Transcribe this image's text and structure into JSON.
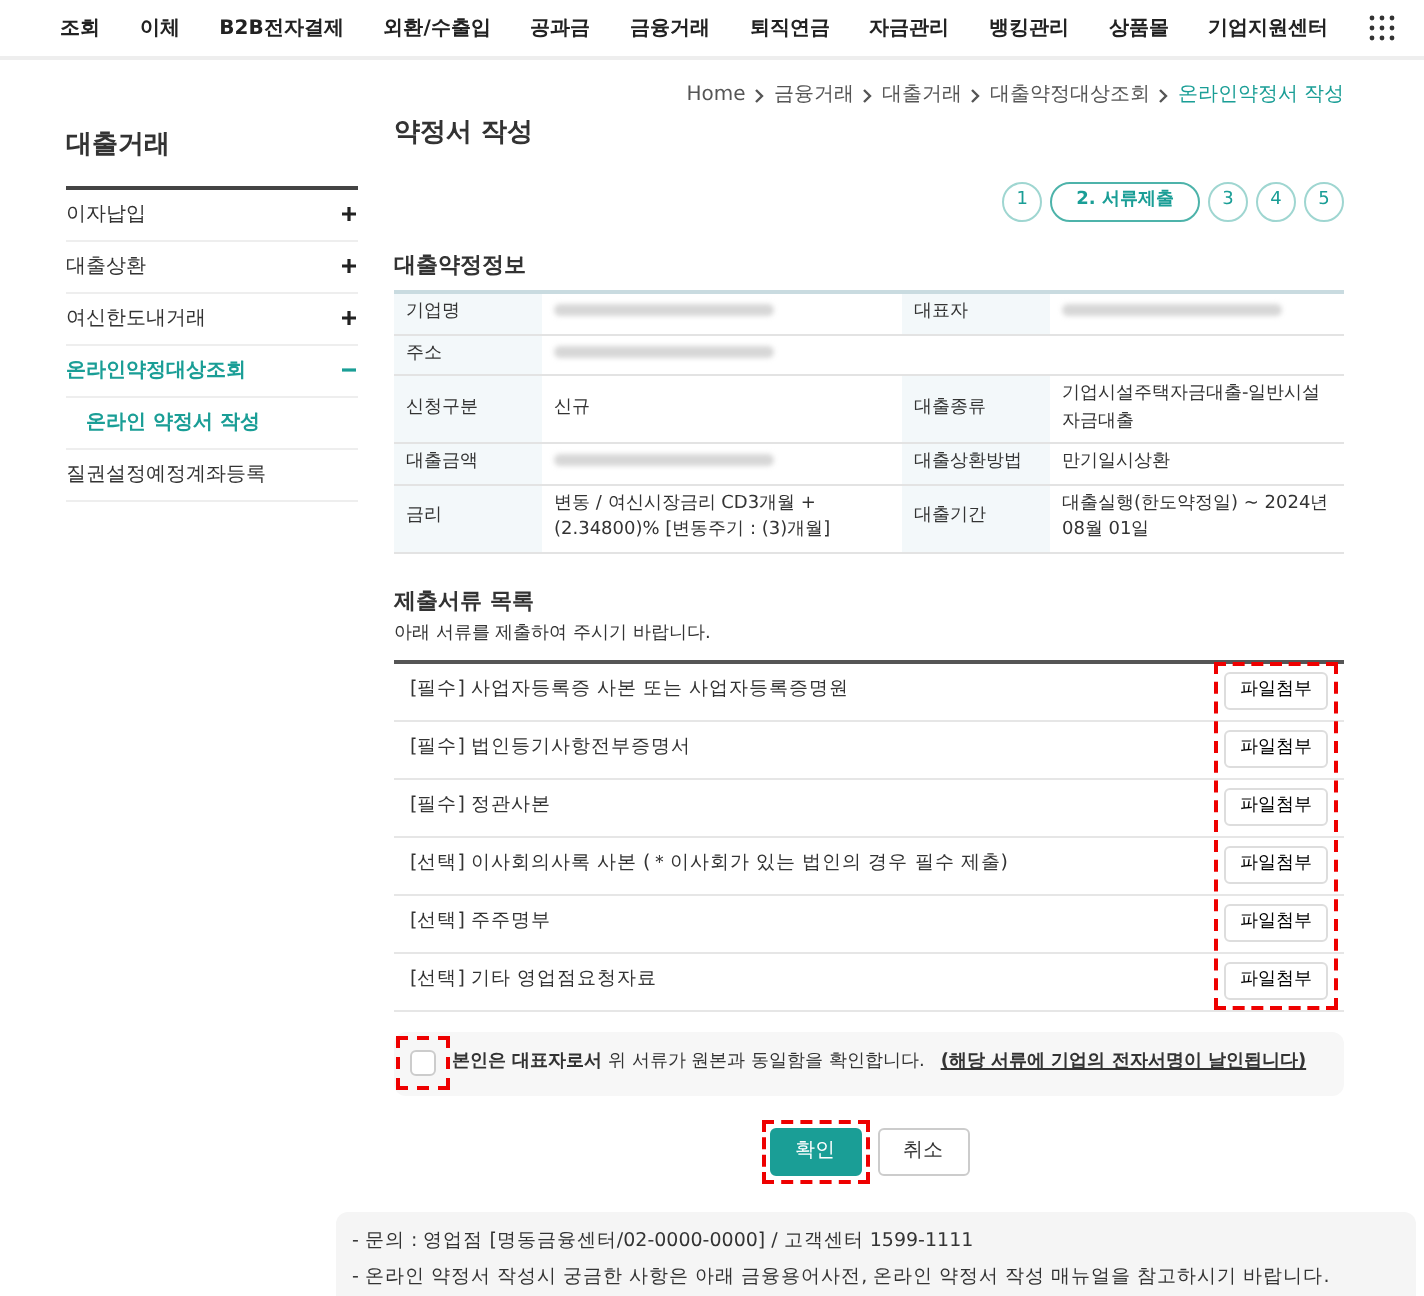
{
  "top_nav": [
    "조회",
    "이체",
    "B2B전자결제",
    "외환/수출입",
    "공과금",
    "금융거래",
    "퇴직연금",
    "자금관리",
    "뱅킹관리",
    "상품몰",
    "기업지원센터"
  ],
  "breadcrumb": [
    {
      "label": "Home",
      "selected": false
    },
    {
      "label": "금융거래",
      "selected": false
    },
    {
      "label": "대출거래",
      "selected": false
    },
    {
      "label": "대출약정대상조회",
      "selected": false
    },
    {
      "label": "온라인약정서 작성",
      "selected": true
    }
  ],
  "sidebar": {
    "title": "대출거래",
    "items": [
      {
        "label": "이자납입",
        "expanded": false,
        "selected": false
      },
      {
        "label": "대출상환",
        "expanded": false,
        "selected": false
      },
      {
        "label": "여신한도내거래",
        "expanded": false,
        "selected": false
      },
      {
        "label": "온라인약정대상조회",
        "expanded": true,
        "selected": true,
        "children": [
          {
            "label": "온라인 약정서 작성",
            "selected": true
          }
        ]
      },
      {
        "label": "질권설정예정계좌등록",
        "selected": false
      }
    ]
  },
  "page_title": "약정서 작성",
  "steps": [
    {
      "label": "1",
      "selected": false
    },
    {
      "label": "2. 서류제출",
      "selected": true
    },
    {
      "label": "3",
      "selected": false
    },
    {
      "label": "4",
      "selected": false
    },
    {
      "label": "5",
      "selected": false
    }
  ],
  "info": {
    "title": "대출약정정보",
    "rows": [
      [
        {
          "label": "기업명",
          "redacted": true
        },
        {
          "label": "대표자",
          "redacted": true
        }
      ],
      [
        {
          "label": "주소",
          "redacted": true
        }
      ],
      [
        {
          "label": "신청구분",
          "value": "신규"
        },
        {
          "label": "대출종류",
          "value": "기업시설주택자금대출-일반시설자금대출"
        }
      ],
      [
        {
          "label": "대출금액",
          "redacted": true
        },
        {
          "label": "대출상환방법",
          "value": "만기일시상환"
        }
      ],
      [
        {
          "label": "금리",
          "value": "변동 / 여신시장금리 CD3개월 + (2.34800)% [변동주기 : (3)개월]"
        },
        {
          "label": "대출기간",
          "value": "대출실행(한도약정일) ~ 2024년 08월 01일"
        }
      ]
    ]
  },
  "documents": {
    "title": "제출서류 목록",
    "subtitle": "아래 서류를 제출하여 주시기 바랍니다.",
    "buttons_highlighted": true,
    "items": [
      {
        "label": "[필수] 사업자등록증 사본 또는 사업자등록증명원",
        "button": "파일첨부"
      },
      {
        "label": "[필수] 법인등기사항전부증명서",
        "button": "파일첨부"
      },
      {
        "label": "[필수] 정관사본",
        "button": "파일첨부"
      },
      {
        "label": "[선택] 이사회의사록 사본 (＊이사회가 있는 법인의 경우 필수 제출)",
        "button": "파일첨부"
      },
      {
        "label": "[선택] 주주명부",
        "button": "파일첨부"
      },
      {
        "label": "[선택] 기타 영업점요청자료",
        "button": "파일첨부"
      }
    ]
  },
  "agreement": {
    "checked": false,
    "highlighted": true,
    "text": "**본인은 대표자로서** 위 서류가 원본과 동일함을 확인합니다.",
    "note": "(해당 서류에 기업의 전자서명이 날인됩니다)"
  },
  "buttons": {
    "primary_highlighted": true,
    "items": [
      {
        "label": "확인",
        "kind": "primary"
      },
      {
        "label": "취소",
        "kind": "secondary"
      }
    ]
  },
  "footer_notes": [
    "- 문의 : 영업점 [명동금융센터/02-0000-0000] / 고객센터 1599-1111",
    "- 온라인 약정서 작성시 궁금한 사항은 아래 금융용어사전, 온라인 약정서 작성 매뉴얼을 참고하시기 바랍니다."
  ]
}
